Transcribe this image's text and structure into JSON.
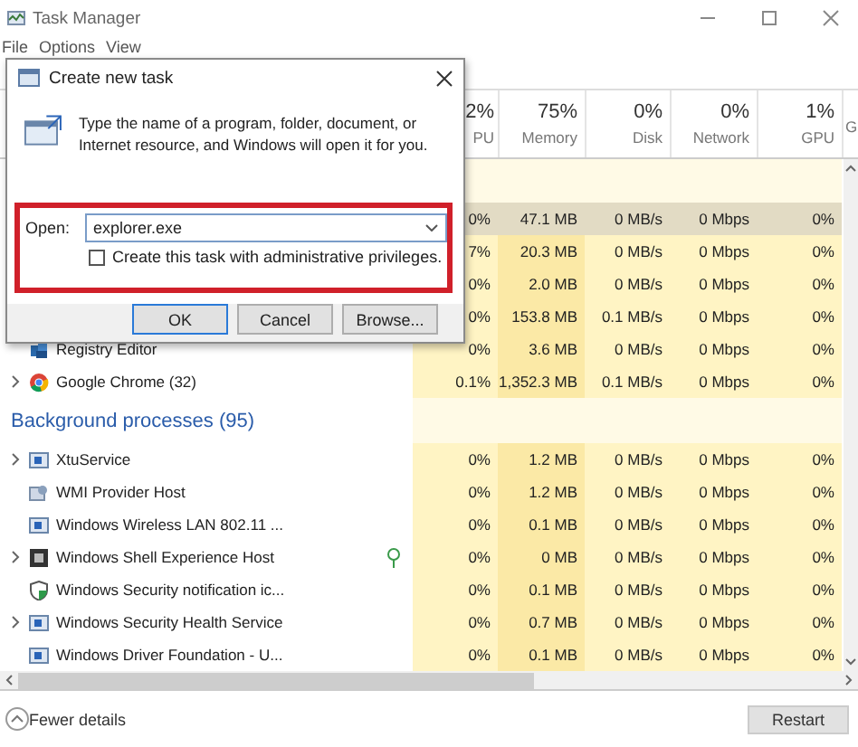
{
  "window": {
    "title": "Task Manager"
  },
  "menu": [
    "File",
    "Options",
    "View"
  ],
  "columns": [
    {
      "percent": "2%",
      "label": "PU"
    },
    {
      "percent": "75%",
      "label": "Memory"
    },
    {
      "percent": "0%",
      "label": "Disk"
    },
    {
      "percent": "0%",
      "label": "Network"
    },
    {
      "percent": "1%",
      "label": "GPU"
    },
    {
      "label": "G"
    }
  ],
  "rows": [
    {
      "kind": "heading"
    },
    {
      "kind": "process",
      "expandable": false,
      "suspended": false,
      "selected": true,
      "cells": [
        "0%",
        "47.1 MB",
        "0 MB/s",
        "0 Mbps",
        "0%"
      ]
    },
    {
      "kind": "process",
      "expandable": false,
      "suspended": false,
      "selected": false,
      "cells": [
        "7%",
        "20.3 MB",
        "0 MB/s",
        "0 Mbps",
        "0%"
      ]
    },
    {
      "kind": "process",
      "expandable": false,
      "suspended": false,
      "selected": false,
      "cells": [
        "0%",
        "2.0 MB",
        "0 MB/s",
        "0 Mbps",
        "0%"
      ]
    },
    {
      "kind": "process",
      "expandable": false,
      "suspended": false,
      "selected": false,
      "cells": [
        "0%",
        "153.8 MB",
        "0.1 MB/s",
        "0 Mbps",
        "0%"
      ]
    },
    {
      "kind": "process",
      "name": "Registry Editor",
      "expandable": false,
      "suspended": false,
      "selected": false,
      "cells": [
        "0%",
        "3.6 MB",
        "0 MB/s",
        "0 Mbps",
        "0%"
      ]
    },
    {
      "kind": "process",
      "name": "Google Chrome (32)",
      "expandable": true,
      "suspended": false,
      "selected": false,
      "cells": [
        "0.1%",
        "1,352.3 MB",
        "0.1 MB/s",
        "0 Mbps",
        "0%"
      ]
    },
    {
      "kind": "heading",
      "title": "Background processes (95)"
    },
    {
      "kind": "process",
      "name": "XtuService",
      "expandable": true,
      "suspended": false,
      "selected": false,
      "cells": [
        "0%",
        "1.2 MB",
        "0 MB/s",
        "0 Mbps",
        "0%"
      ]
    },
    {
      "kind": "process",
      "name": "WMI Provider Host",
      "expandable": false,
      "suspended": false,
      "selected": false,
      "cells": [
        "0%",
        "1.2 MB",
        "0 MB/s",
        "0 Mbps",
        "0%"
      ]
    },
    {
      "kind": "process",
      "name": "Windows Wireless LAN 802.11 ...",
      "expandable": false,
      "suspended": false,
      "selected": false,
      "cells": [
        "0%",
        "0.1 MB",
        "0 MB/s",
        "0 Mbps",
        "0%"
      ]
    },
    {
      "kind": "process",
      "name": "Windows Shell Experience Host",
      "expandable": true,
      "suspended": true,
      "selected": false,
      "cells": [
        "0%",
        "0 MB",
        "0 MB/s",
        "0 Mbps",
        "0%"
      ]
    },
    {
      "kind": "process",
      "name": "Windows Security notification ic...",
      "expandable": false,
      "suspended": false,
      "selected": false,
      "cells": [
        "0%",
        "0.1 MB",
        "0 MB/s",
        "0 Mbps",
        "0%"
      ]
    },
    {
      "kind": "process",
      "name": "Windows Security Health Service",
      "expandable": true,
      "suspended": false,
      "selected": false,
      "cells": [
        "0%",
        "0.7 MB",
        "0 MB/s",
        "0 Mbps",
        "0%"
      ]
    },
    {
      "kind": "process",
      "name": "Windows Driver Foundation - U...",
      "expandable": false,
      "suspended": false,
      "selected": false,
      "cells": [
        "0%",
        "0.1 MB",
        "0 MB/s",
        "0 Mbps",
        "0%"
      ]
    }
  ],
  "dialog": {
    "title": "Create new task",
    "message": "Type the name of a program, folder, document, or Internet resource, and Windows will open it for you.",
    "open_label": "Open:",
    "value": "explorer.exe",
    "highlighted": true,
    "checkbox": {
      "label": "Create this task with administrative privileges.",
      "checked": false
    },
    "buttons": [
      {
        "label": "OK",
        "default": true
      },
      {
        "label": "Cancel",
        "default": false
      },
      {
        "label": "Browse...",
        "default": false
      }
    ]
  },
  "footer": {
    "toggle": "Fewer details",
    "button": "Restart"
  }
}
